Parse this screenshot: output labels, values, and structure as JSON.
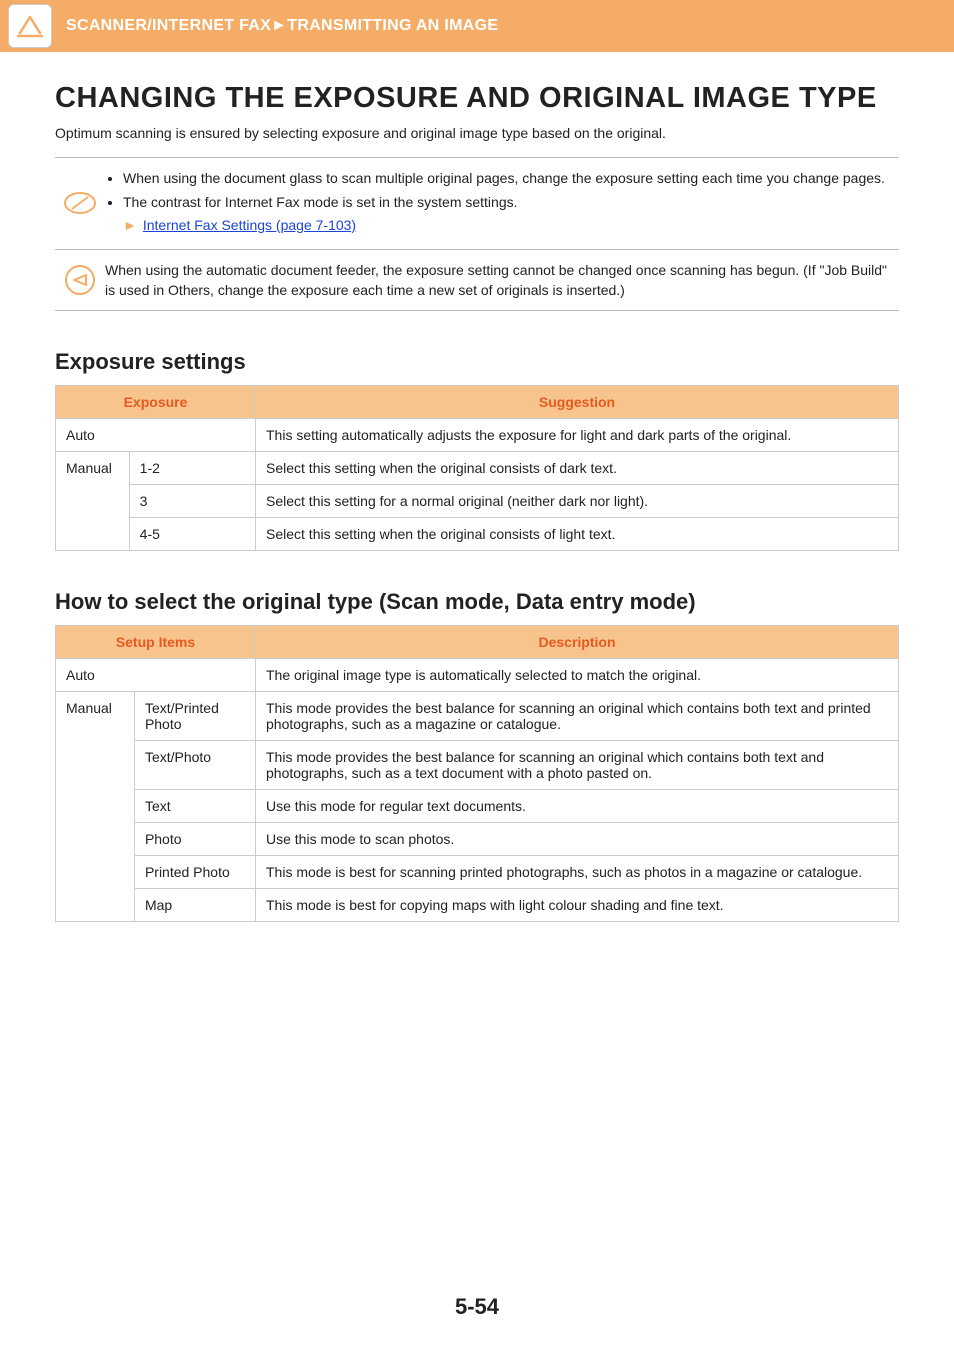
{
  "header": {
    "breadcrumb_left": "SCANNER/INTERNET FAX",
    "breadcrumb_sep": "►",
    "breadcrumb_right": "TRANSMITTING AN IMAGE"
  },
  "title": "CHANGING THE EXPOSURE AND ORIGINAL IMAGE TYPE",
  "intro": "Optimum scanning is ensured by selecting exposure and original image type based on the original.",
  "note1": {
    "bullet1": "When using the document glass to scan multiple original pages, change the exposure setting each time you change pages.",
    "bullet2": "The contrast for Internet Fax mode is set in the system settings.",
    "link_arrow": "►",
    "link_text": "Internet Fax Settings (page 7-103)"
  },
  "note2": {
    "text": "When using the automatic document feeder, the exposure setting cannot be changed once scanning has begun. (If \"Job Build\" is used in Others, change the exposure each time a new set of originals is inserted.)"
  },
  "section1": {
    "heading": "Exposure settings",
    "col1": "Exposure",
    "col2": "Suggestion",
    "rows": {
      "auto_label": "Auto",
      "auto_desc": "This setting automatically adjusts the exposure for light and dark parts of the original.",
      "manual_label": "Manual",
      "r1_val": "1-2",
      "r1_desc": "Select this setting when the original consists of dark text.",
      "r2_val": "3",
      "r2_desc": "Select this setting for a normal original (neither dark nor light).",
      "r3_val": "4-5",
      "r3_desc": "Select this setting when the original consists of light text."
    }
  },
  "section2": {
    "heading": "How to select the original type (Scan mode, Data entry mode)",
    "col1": "Setup Items",
    "col2": "Description",
    "rows": {
      "auto_label": "Auto",
      "auto_desc": "The original image type is automatically selected to match the original.",
      "manual_label": "Manual",
      "r1_val": "Text/Printed Photo",
      "r1_desc": "This mode provides the best balance for scanning an original which contains both text and printed photographs, such as a magazine or catalogue.",
      "r2_val": "Text/Photo",
      "r2_desc": "This mode provides the best balance for scanning an original which contains both text and photographs, such as a text document with a photo pasted on.",
      "r3_val": "Text",
      "r3_desc": "Use this mode for regular text documents.",
      "r4_val": "Photo",
      "r4_desc": "Use this mode to scan photos.",
      "r5_val": "Printed Photo",
      "r5_desc": "This mode is best for scanning printed photographs, such as photos in a magazine or catalogue.",
      "r6_val": "Map",
      "r6_desc": "This mode is best for copying maps with light colour shading and fine text."
    }
  },
  "page_number": "5-54"
}
